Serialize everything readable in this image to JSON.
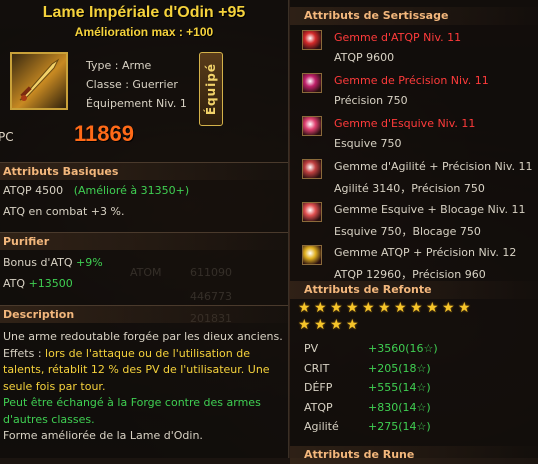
{
  "item": {
    "title": "Lame Impériale d'Odin  +95",
    "subtitle": "Amélioration max : +100",
    "type": "Type : Arme",
    "class": "Classe : Guerrier",
    "equip_level": "Équipement Niv. 1",
    "equip_button": "Équipé",
    "pc_label": "PC",
    "pc_value": "11869"
  },
  "basic": {
    "heading": "Attributs Basiques",
    "atqp_label": "ATQP  4500",
    "atqp_improved": "(Amélioré à 31350+)",
    "atq_combat": "ATQ en combat +3 %."
  },
  "purify": {
    "heading": "Purifier",
    "bonus_label": "Bonus d'ATQ",
    "bonus_value": "+9%",
    "atq_label": "ATQ",
    "atq_value": "+13500"
  },
  "description": {
    "heading": "Description",
    "lines": [
      {
        "text": "Une arme redoutable forgée par les dieux anciens.",
        "color": "#d8d2c4"
      },
      {
        "prefix": "Effets : ",
        "text": "lors de l'attaque ou de l'utilisation de",
        "color": "#f5d23c"
      },
      {
        "text": "talents, rétablit 12 % des PV de l'utilisateur. Une",
        "color": "#f5d23c"
      },
      {
        "text": "seule fois par tour.",
        "color": "#f5d23c"
      },
      {
        "text": "Peut être échangé à la Forge contre des armes",
        "color": "#3fcf52"
      },
      {
        "text": "d'autres classes.",
        "color": "#3fcf52"
      },
      {
        "text": "Forme améliorée de la Lame d'Odin.",
        "color": "#d8d2c4"
      }
    ]
  },
  "sertissage": {
    "heading": "Attributs de Sertissage",
    "gems": [
      {
        "name": "Gemme d'ATQP Niv. 11",
        "stat": "ATQP 9600",
        "name_color": "#ff3b3b",
        "icon_color": "#d42a2a"
      },
      {
        "name": "Gemme de Précision Niv. 11",
        "stat": "Précision 750",
        "name_color": "#ff3b3b",
        "icon_color": "#c0206a"
      },
      {
        "name": "Gemme d'Esquive Niv. 11",
        "stat": "Esquive 750",
        "name_color": "#ff3b3b",
        "icon_color": "#e04070"
      },
      {
        "name": "Gemme d'Agilité + Précision Niv. 11",
        "stat": "Agilité 3140，Précision 750",
        "name_color": "#d8d2c4",
        "icon_color": "#c04040"
      },
      {
        "name": "Gemme Esquive + Blocage Niv. 11",
        "stat": "Esquive 750，Blocage 750",
        "name_color": "#d8d2c4",
        "icon_color": "#e05050"
      },
      {
        "name": "Gemme ATQP + Précision Niv. 12",
        "stat": "ATQP 12960，Précision 960",
        "name_color": "#d8d2c4",
        "icon_color": "#e0b020"
      }
    ]
  },
  "refonte": {
    "heading": "Attributs de Refonte",
    "stars": 15,
    "stats": [
      {
        "label": "PV",
        "value": "+3560(16☆)"
      },
      {
        "label": "CRIT",
        "value": "+205(18☆)"
      },
      {
        "label": "DÉFP",
        "value": "+555(14☆)"
      },
      {
        "label": "ATQP",
        "value": "+830(14☆)"
      },
      {
        "label": "Agilité",
        "value": "+275(14☆)"
      }
    ]
  },
  "rune": {
    "heading": "Attributs de Rune"
  },
  "colors": {
    "title": "#f5d23c",
    "pc": "#ff6a18",
    "heading": "#f3b77c",
    "positive": "#3fcf52",
    "negative": "#ff3b3b"
  }
}
